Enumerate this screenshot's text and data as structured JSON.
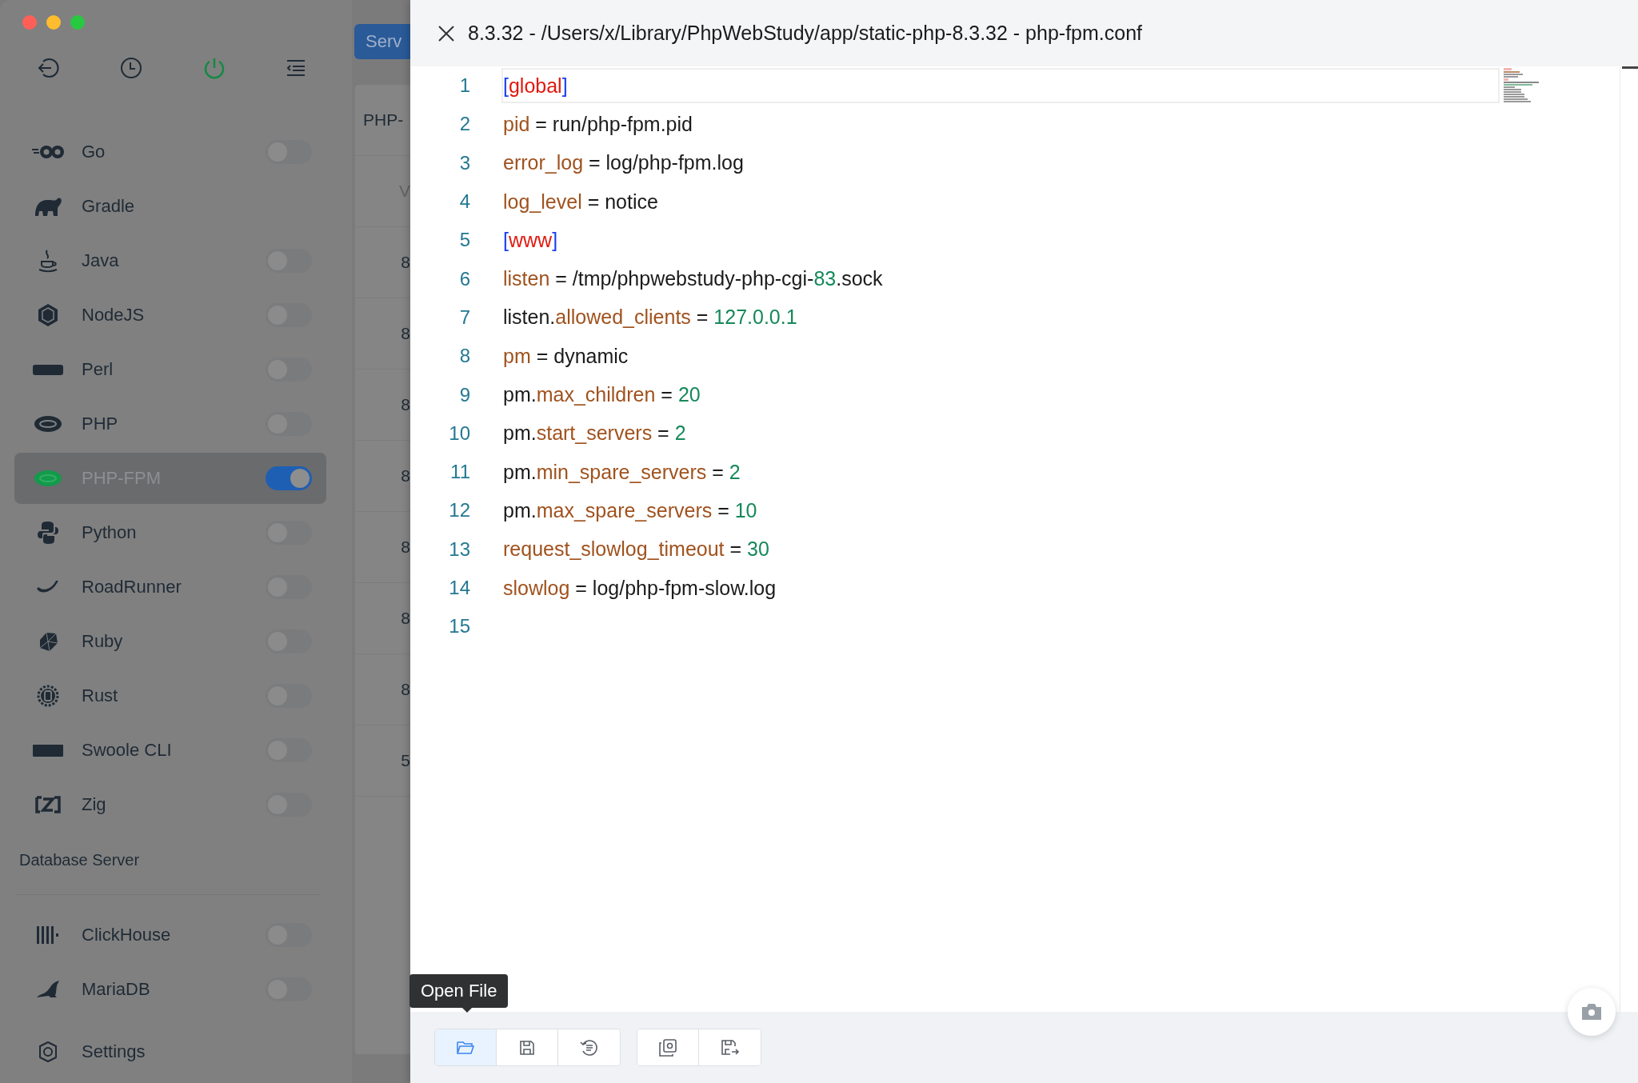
{
  "sidebar": {
    "window_controls": [
      {
        "color": "#ff5f57"
      },
      {
        "color": "#febc2e"
      },
      {
        "color": "#28c840"
      }
    ],
    "items": [
      {
        "label": "Go",
        "kind": "toggle",
        "on": false,
        "selected": false
      },
      {
        "label": "Gradle",
        "kind": "plain",
        "selected": false
      },
      {
        "label": "Java",
        "kind": "toggle",
        "on": false,
        "selected": false
      },
      {
        "label": "NodeJS",
        "kind": "toggle",
        "on": false,
        "selected": false
      },
      {
        "label": "Perl",
        "kind": "toggle",
        "on": false,
        "selected": false
      },
      {
        "label": "PHP",
        "kind": "toggle",
        "on": false,
        "selected": false
      },
      {
        "label": "PHP-FPM",
        "kind": "toggle",
        "on": true,
        "selected": true
      },
      {
        "label": "Python",
        "kind": "toggle",
        "on": false,
        "selected": false
      },
      {
        "label": "RoadRunner",
        "kind": "toggle",
        "on": false,
        "selected": false
      },
      {
        "label": "Ruby",
        "kind": "toggle",
        "on": false,
        "selected": false
      },
      {
        "label": "Rust",
        "kind": "toggle",
        "on": false,
        "selected": false
      },
      {
        "label": "Swoole CLI",
        "kind": "toggle",
        "on": false,
        "selected": false
      },
      {
        "label": "Zig",
        "kind": "toggle",
        "on": false,
        "selected": false
      }
    ],
    "section_title": "Database Server",
    "database_items": [
      {
        "label": "ClickHouse",
        "kind": "toggle",
        "on": false,
        "selected": false
      },
      {
        "label": "MariaDB",
        "kind": "toggle",
        "on": false,
        "selected": false
      }
    ],
    "settings": "Settings"
  },
  "background_panel": {
    "tab_button": "Serv",
    "card_title": "PHP-",
    "table": {
      "columns": [
        "V"
      ],
      "rows": [
        "8",
        "8",
        "8",
        "8",
        "8",
        "8",
        "8",
        "5"
      ]
    }
  },
  "editor": {
    "title": "8.3.32 - /Users/x/Library/PhpWebStudy/app/static-php-8.3.32 - php-fpm.conf",
    "lines": [
      {
        "number": "1",
        "current": true,
        "tokens": [
          {
            "text": "[",
            "kind": "bracket"
          },
          {
            "text": "global",
            "kind": "section"
          },
          {
            "text": "]",
            "kind": "bracket"
          }
        ]
      },
      {
        "number": "2",
        "current": false,
        "tokens": [
          {
            "text": "pid",
            "kind": "key"
          },
          {
            "text": " = run/php-fpm.pid",
            "kind": "plain"
          }
        ]
      },
      {
        "number": "3",
        "current": false,
        "tokens": [
          {
            "text": "error_log",
            "kind": "key"
          },
          {
            "text": " = log/php-fpm.log",
            "kind": "plain"
          }
        ]
      },
      {
        "number": "4",
        "current": false,
        "tokens": [
          {
            "text": "log_level",
            "kind": "key"
          },
          {
            "text": " = notice",
            "kind": "plain"
          }
        ]
      },
      {
        "number": "5",
        "current": false,
        "tokens": [
          {
            "text": "[",
            "kind": "bracket"
          },
          {
            "text": "www",
            "kind": "section"
          },
          {
            "text": "]",
            "kind": "bracket"
          }
        ]
      },
      {
        "number": "6",
        "current": false,
        "tokens": [
          {
            "text": "listen",
            "kind": "key"
          },
          {
            "text": " = /tmp/phpwebstudy-php-cgi-",
            "kind": "plain"
          },
          {
            "text": "83",
            "kind": "number"
          },
          {
            "text": ".sock",
            "kind": "plain"
          }
        ]
      },
      {
        "number": "7",
        "current": false,
        "tokens": [
          {
            "text": "listen.",
            "kind": "plain"
          },
          {
            "text": "allowed_clients",
            "kind": "key"
          },
          {
            "text": " = ",
            "kind": "plain"
          },
          {
            "text": "127.0.0.1",
            "kind": "number"
          }
        ]
      },
      {
        "number": "8",
        "current": false,
        "tokens": [
          {
            "text": "pm",
            "kind": "key"
          },
          {
            "text": " = dynamic",
            "kind": "plain"
          }
        ]
      },
      {
        "number": "9",
        "current": false,
        "tokens": [
          {
            "text": "pm.",
            "kind": "plain"
          },
          {
            "text": "max_children",
            "kind": "key"
          },
          {
            "text": " = ",
            "kind": "plain"
          },
          {
            "text": "20",
            "kind": "number"
          }
        ]
      },
      {
        "number": "10",
        "current": false,
        "tokens": [
          {
            "text": "pm.",
            "kind": "plain"
          },
          {
            "text": "start_servers",
            "kind": "key"
          },
          {
            "text": " = ",
            "kind": "plain"
          },
          {
            "text": "2",
            "kind": "number"
          }
        ]
      },
      {
        "number": "11",
        "current": false,
        "tokens": [
          {
            "text": "pm.",
            "kind": "plain"
          },
          {
            "text": "min_spare_servers",
            "kind": "key"
          },
          {
            "text": " = ",
            "kind": "plain"
          },
          {
            "text": "2",
            "kind": "number"
          }
        ]
      },
      {
        "number": "12",
        "current": false,
        "tokens": [
          {
            "text": "pm.",
            "kind": "plain"
          },
          {
            "text": "max_spare_servers",
            "kind": "key"
          },
          {
            "text": " = ",
            "kind": "plain"
          },
          {
            "text": "10",
            "kind": "number"
          }
        ]
      },
      {
        "number": "13",
        "current": false,
        "tokens": [
          {
            "text": "request_slowlog_timeout",
            "kind": "key"
          },
          {
            "text": " = ",
            "kind": "plain"
          },
          {
            "text": "30",
            "kind": "number"
          }
        ]
      },
      {
        "number": "14",
        "current": false,
        "tokens": [
          {
            "text": "slowlog",
            "kind": "key"
          },
          {
            "text": " = log/php-fpm-slow.log",
            "kind": "plain"
          }
        ]
      },
      {
        "number": "15",
        "current": false
      }
    ],
    "toolbar": [
      {
        "selected": true
      },
      {
        "selected": false
      },
      {
        "selected": false
      },
      {
        "selected": false
      },
      {
        "selected": false
      }
    ],
    "tooltip": "Open File"
  }
}
